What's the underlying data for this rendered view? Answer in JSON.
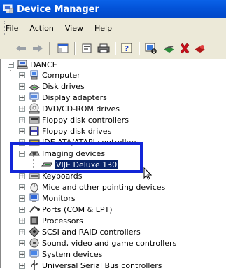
{
  "window": {
    "title": "Device Manager",
    "icon": "device-manager-icon"
  },
  "menu": [
    "File",
    "Action",
    "View",
    "Help"
  ],
  "toolbar": [
    "back-arrow-icon",
    "forward-arrow-icon",
    "show-hide-tree-icon",
    "properties-icon",
    "print-icon",
    "help-icon",
    "scan-hardware-icon",
    "update-driver-icon",
    "uninstall-icon",
    "disable-icon"
  ],
  "tree": {
    "root": "DANCE",
    "categories": [
      "Computer",
      "Disk drives",
      "Display adapters",
      "DVD/CD-ROM drives",
      "Floppy disk controllers",
      "Floppy disk drives",
      "IDE ATA/ATAPI controllers",
      "Imaging devices",
      "Keyboards",
      "Mice and other pointing devices",
      "Monitors",
      "Ports (COM & LPT)",
      "Processors",
      "SCSI and RAID controllers",
      "Sound, video and game controllers",
      "System devices",
      "Universal Serial Bus controllers"
    ],
    "selected_device": "VIJE Deluxe 130"
  },
  "colors": {
    "titlebar": "#0353d8",
    "highlight_border": "#1226d8",
    "selection": "#0a246a"
  }
}
